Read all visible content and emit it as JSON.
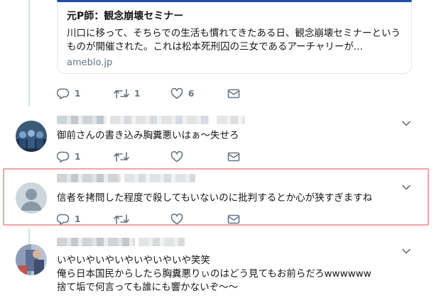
{
  "card": {
    "title": "元P師：観念崩壊セミナー",
    "description": "川口に移って、そちらでの生活も慣れてきたある日、観念崩壊セミナーというものが開催された。これは松本死刑囚の三女であるアーチャリーが...",
    "domain": "ameblo.jp"
  },
  "tweet0_actions": {
    "reply": "1",
    "retweet": "1",
    "like": "6"
  },
  "tweet1": {
    "text": "御前さんの書き込み胸糞悪いはぁ～失せろ",
    "actions": {
      "reply": "1"
    }
  },
  "tweet2": {
    "text": "信者を拷問した程度で殺してもいないのに批判するとか心が狭すぎますね",
    "actions": {
      "reply": "1"
    }
  },
  "tweet3": {
    "lines": [
      "いやいやいやいやいやいやいや笑笑",
      "俺ら日本国民からしたら胸糞悪りぃのはどう見てもお前らだろwwwwww",
      "捨て垢で何言っても誰にも響かないぞ〜〜"
    ]
  },
  "colors": {
    "highlight": "#f4a4a4",
    "card_accent": "#1b4fa8",
    "thread_line": "#cce9e0",
    "icon_gray": "#657786"
  }
}
